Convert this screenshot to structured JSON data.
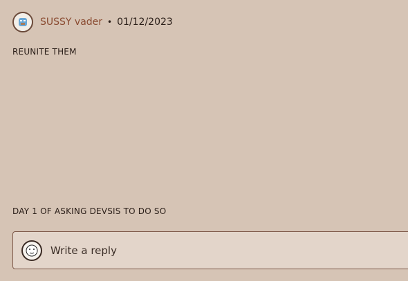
{
  "post": {
    "author_name": "SUSSY vader",
    "separator": "•",
    "date": "01/12/2023",
    "body_line_1": "REUNITE THEM",
    "body_line_2": "DAY 1 OF ASKING DEVSIS TO DO SO"
  },
  "reply": {
    "placeholder": "Write a reply"
  },
  "colors": {
    "background": "#d6c4b5",
    "reply_box_background": "#e3d5ca",
    "author_color": "#8a4b31"
  },
  "icons": {
    "author_avatar": "avatar-icon",
    "reply_avatar": "user-avatar-icon"
  }
}
